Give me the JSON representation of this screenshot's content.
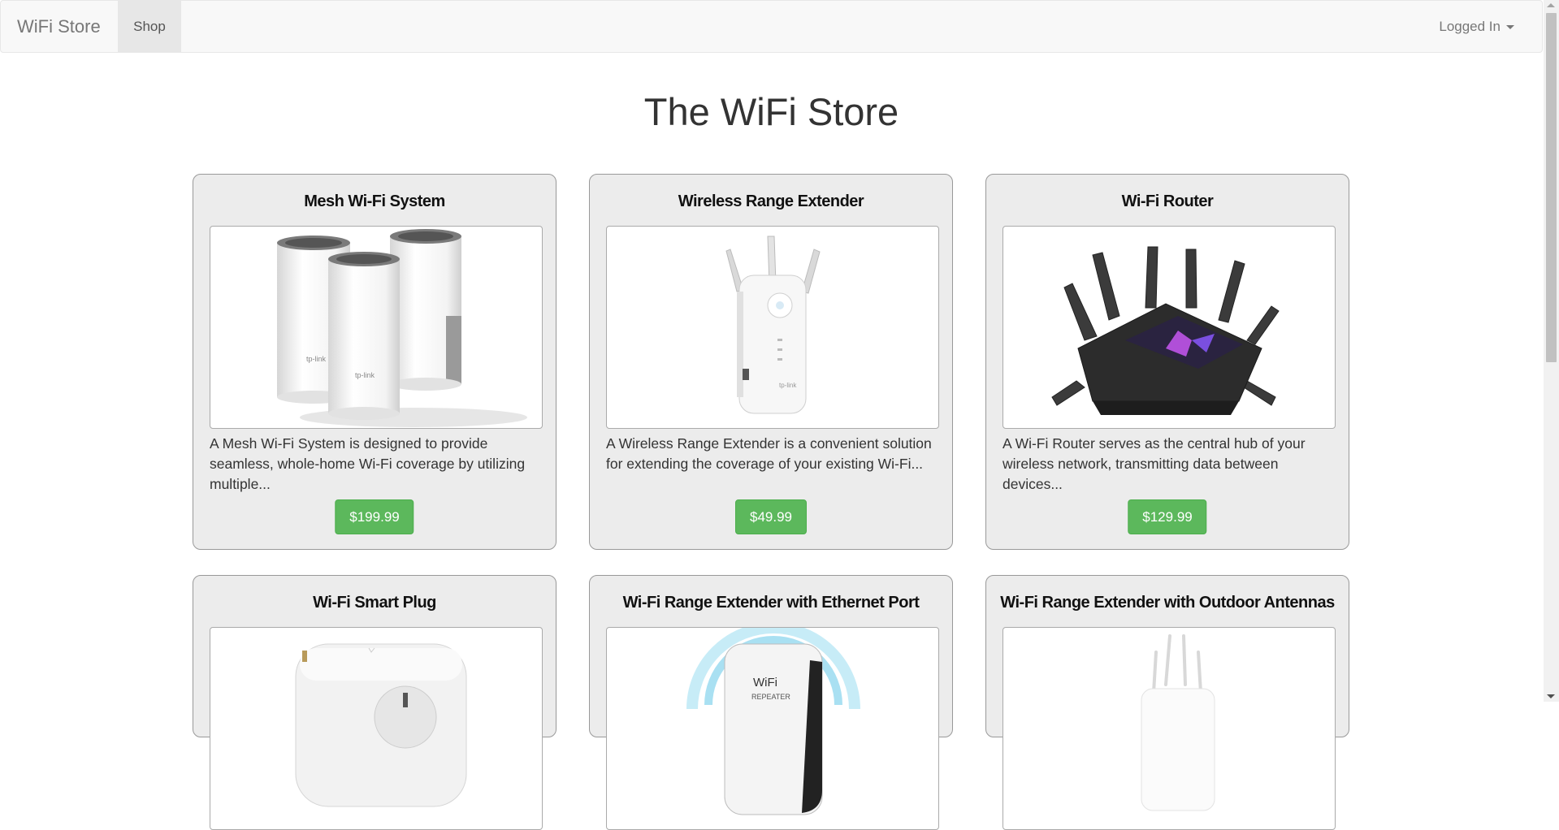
{
  "navbar": {
    "brand": "WiFi Store",
    "shop_label": "Shop",
    "user_label": "Logged In"
  },
  "page": {
    "title": "The WiFi Store"
  },
  "products": [
    {
      "name": "Mesh Wi-Fi System",
      "description": "A Mesh Wi-Fi System is designed to provide seamless, whole-home Wi-Fi coverage by utilizing multiple...",
      "price": "$199.99",
      "image_label": "tp-link"
    },
    {
      "name": "Wireless Range Extender",
      "description": "A Wireless Range Extender is a convenient solution for extending the coverage of your existing Wi-Fi...",
      "price": "$49.99",
      "image_label": "tp-link"
    },
    {
      "name": "Wi-Fi Router",
      "description": "A Wi-Fi Router serves as the central hub of your wireless network, transmitting data between devices...",
      "price": "$129.99"
    },
    {
      "name": "Wi-Fi Smart Plug"
    },
    {
      "name": "Wi-Fi Range Extender with Ethernet Port",
      "image_label_1": "WiFi",
      "image_label_2": "REPEATER"
    },
    {
      "name": "Wi-Fi Range Extender with Outdoor Antennas"
    }
  ],
  "colors": {
    "price_button": "#5cb85c",
    "card_bg": "#ececec",
    "navbar_bg": "#f8f8f8"
  }
}
